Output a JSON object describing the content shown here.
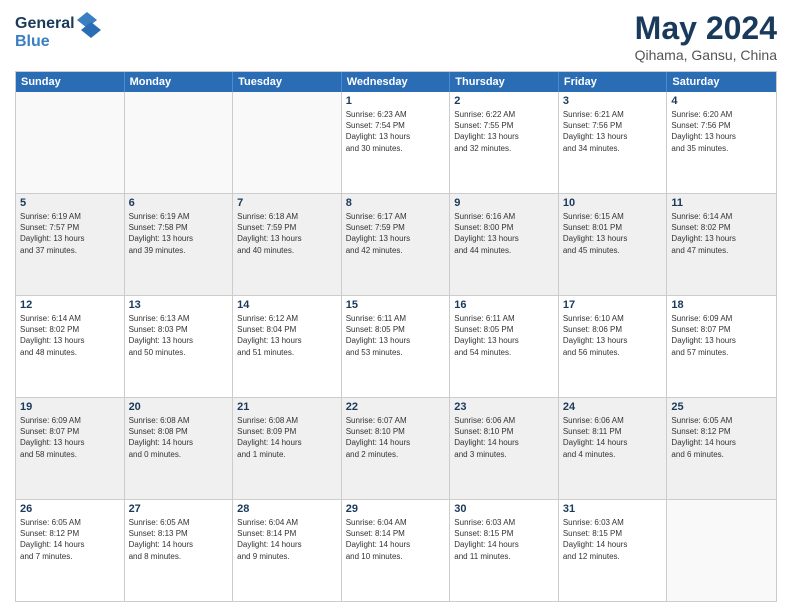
{
  "logo": {
    "line1": "General",
    "line2": "Blue"
  },
  "title": "May 2024",
  "location": "Qihama, Gansu, China",
  "days_of_week": [
    "Sunday",
    "Monday",
    "Tuesday",
    "Wednesday",
    "Thursday",
    "Friday",
    "Saturday"
  ],
  "weeks": [
    [
      {
        "day": "",
        "info": ""
      },
      {
        "day": "",
        "info": ""
      },
      {
        "day": "",
        "info": ""
      },
      {
        "day": "1",
        "info": "Sunrise: 6:23 AM\nSunset: 7:54 PM\nDaylight: 13 hours\nand 30 minutes."
      },
      {
        "day": "2",
        "info": "Sunrise: 6:22 AM\nSunset: 7:55 PM\nDaylight: 13 hours\nand 32 minutes."
      },
      {
        "day": "3",
        "info": "Sunrise: 6:21 AM\nSunset: 7:56 PM\nDaylight: 13 hours\nand 34 minutes."
      },
      {
        "day": "4",
        "info": "Sunrise: 6:20 AM\nSunset: 7:56 PM\nDaylight: 13 hours\nand 35 minutes."
      }
    ],
    [
      {
        "day": "5",
        "info": "Sunrise: 6:19 AM\nSunset: 7:57 PM\nDaylight: 13 hours\nand 37 minutes."
      },
      {
        "day": "6",
        "info": "Sunrise: 6:19 AM\nSunset: 7:58 PM\nDaylight: 13 hours\nand 39 minutes."
      },
      {
        "day": "7",
        "info": "Sunrise: 6:18 AM\nSunset: 7:59 PM\nDaylight: 13 hours\nand 40 minutes."
      },
      {
        "day": "8",
        "info": "Sunrise: 6:17 AM\nSunset: 7:59 PM\nDaylight: 13 hours\nand 42 minutes."
      },
      {
        "day": "9",
        "info": "Sunrise: 6:16 AM\nSunset: 8:00 PM\nDaylight: 13 hours\nand 44 minutes."
      },
      {
        "day": "10",
        "info": "Sunrise: 6:15 AM\nSunset: 8:01 PM\nDaylight: 13 hours\nand 45 minutes."
      },
      {
        "day": "11",
        "info": "Sunrise: 6:14 AM\nSunset: 8:02 PM\nDaylight: 13 hours\nand 47 minutes."
      }
    ],
    [
      {
        "day": "12",
        "info": "Sunrise: 6:14 AM\nSunset: 8:02 PM\nDaylight: 13 hours\nand 48 minutes."
      },
      {
        "day": "13",
        "info": "Sunrise: 6:13 AM\nSunset: 8:03 PM\nDaylight: 13 hours\nand 50 minutes."
      },
      {
        "day": "14",
        "info": "Sunrise: 6:12 AM\nSunset: 8:04 PM\nDaylight: 13 hours\nand 51 minutes."
      },
      {
        "day": "15",
        "info": "Sunrise: 6:11 AM\nSunset: 8:05 PM\nDaylight: 13 hours\nand 53 minutes."
      },
      {
        "day": "16",
        "info": "Sunrise: 6:11 AM\nSunset: 8:05 PM\nDaylight: 13 hours\nand 54 minutes."
      },
      {
        "day": "17",
        "info": "Sunrise: 6:10 AM\nSunset: 8:06 PM\nDaylight: 13 hours\nand 56 minutes."
      },
      {
        "day": "18",
        "info": "Sunrise: 6:09 AM\nSunset: 8:07 PM\nDaylight: 13 hours\nand 57 minutes."
      }
    ],
    [
      {
        "day": "19",
        "info": "Sunrise: 6:09 AM\nSunset: 8:07 PM\nDaylight: 13 hours\nand 58 minutes."
      },
      {
        "day": "20",
        "info": "Sunrise: 6:08 AM\nSunset: 8:08 PM\nDaylight: 14 hours\nand 0 minutes."
      },
      {
        "day": "21",
        "info": "Sunrise: 6:08 AM\nSunset: 8:09 PM\nDaylight: 14 hours\nand 1 minute."
      },
      {
        "day": "22",
        "info": "Sunrise: 6:07 AM\nSunset: 8:10 PM\nDaylight: 14 hours\nand 2 minutes."
      },
      {
        "day": "23",
        "info": "Sunrise: 6:06 AM\nSunset: 8:10 PM\nDaylight: 14 hours\nand 3 minutes."
      },
      {
        "day": "24",
        "info": "Sunrise: 6:06 AM\nSunset: 8:11 PM\nDaylight: 14 hours\nand 4 minutes."
      },
      {
        "day": "25",
        "info": "Sunrise: 6:05 AM\nSunset: 8:12 PM\nDaylight: 14 hours\nand 6 minutes."
      }
    ],
    [
      {
        "day": "26",
        "info": "Sunrise: 6:05 AM\nSunset: 8:12 PM\nDaylight: 14 hours\nand 7 minutes."
      },
      {
        "day": "27",
        "info": "Sunrise: 6:05 AM\nSunset: 8:13 PM\nDaylight: 14 hours\nand 8 minutes."
      },
      {
        "day": "28",
        "info": "Sunrise: 6:04 AM\nSunset: 8:14 PM\nDaylight: 14 hours\nand 9 minutes."
      },
      {
        "day": "29",
        "info": "Sunrise: 6:04 AM\nSunset: 8:14 PM\nDaylight: 14 hours\nand 10 minutes."
      },
      {
        "day": "30",
        "info": "Sunrise: 6:03 AM\nSunset: 8:15 PM\nDaylight: 14 hours\nand 11 minutes."
      },
      {
        "day": "31",
        "info": "Sunrise: 6:03 AM\nSunset: 8:15 PM\nDaylight: 14 hours\nand 12 minutes."
      },
      {
        "day": "",
        "info": ""
      }
    ]
  ]
}
